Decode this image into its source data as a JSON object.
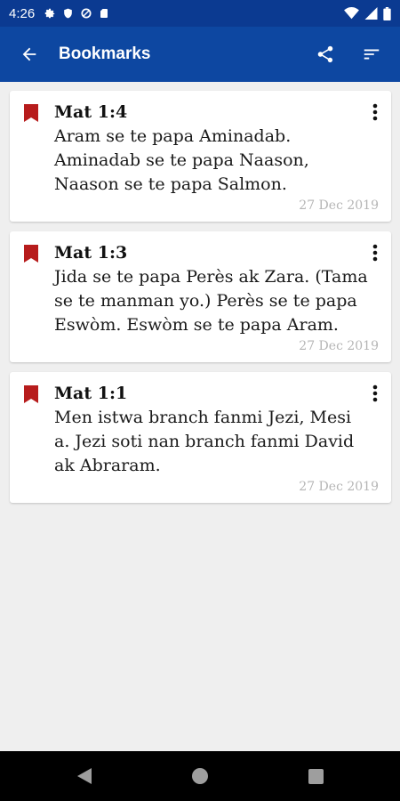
{
  "status_bar": {
    "time": "4:26"
  },
  "app_bar": {
    "title": "Bookmarks"
  },
  "bookmarks": [
    {
      "ref": "Mat 1:4",
      "text": "Aram se te papa Aminadab. Aminadab se te papa Naason, Naason se te papa Salmon.",
      "date": "27 Dec 2019"
    },
    {
      "ref": "Mat 1:3",
      "text": "Jida se te papa Perès ak Zara. (Tama se te manman yo.) Perès se te papa Eswòm. Eswòm se te papa Aram.",
      "date": "27 Dec 2019"
    },
    {
      "ref": "Mat 1:1",
      "text": "Men istwa branch fanmi Jezi, Mesi a. Jezi soti nan branch fanmi David ak Abraram.",
      "date": "27 Dec 2019"
    }
  ],
  "colors": {
    "appbar": "#0d47a1",
    "statusbar": "#0b3a91",
    "bookmark": "#b71c1c",
    "background": "#efefef"
  },
  "icons": {
    "back": "arrow-back-icon",
    "share": "share-icon",
    "sort": "sort-icon",
    "bookmark": "bookmark-icon",
    "menu": "more-vert-icon"
  }
}
